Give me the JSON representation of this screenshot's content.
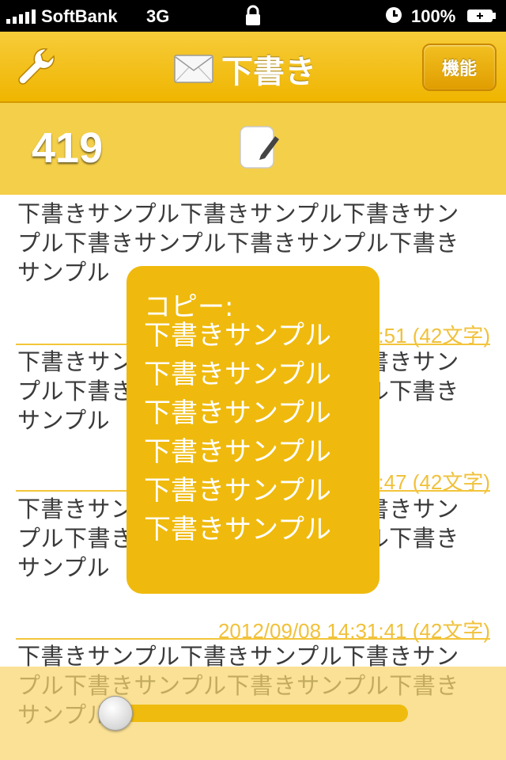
{
  "status_bar": {
    "carrier": "SoftBank",
    "network": "3G",
    "battery": "100%",
    "icons": [
      "signal-bars",
      "lock-icon",
      "clock-icon",
      "battery-icon"
    ]
  },
  "nav": {
    "title": "下書き",
    "function_button": "機能",
    "icons": [
      "wrench-icon",
      "mail-icon"
    ]
  },
  "count_bar": {
    "count": "419",
    "icon": "compose-icon"
  },
  "entries": [
    {
      "text": "下書きサンプル下書きサンプル下書きサンプル下書きサンプル下書きサンプル下書きサンプル",
      "meta": "2012/09/08 14:31:51 (42文字)"
    },
    {
      "text": "下書きサンプル下書きサンプル下書きサンプル下書きサンプル下書きサンプル下書きサンプル",
      "meta": "2012/09/08 14:31:47 (42文字)"
    },
    {
      "text": "下書きサンプル下書きサンプル下書きサンプル下書きサンプル下書きサンプル下書きサンプル",
      "meta": "2012/09/08 14:31:41 (42文字)"
    },
    {
      "text": "下書きサンプル下書きサンプル下書きサンプル下書きサンプル下書きサンプル下書きサンプル"
    }
  ],
  "popup": {
    "title": "コピー:",
    "text": "下書きサンプル下書きサンプル下書きサンプル下書きサンプル下書きサンプル下書きサンプル"
  },
  "slider": {
    "value": 0
  },
  "colors": {
    "accent": "#efba0d",
    "nav": "#f2c021",
    "count_bar": "#f4cf49",
    "meta": "#f0c13a"
  }
}
